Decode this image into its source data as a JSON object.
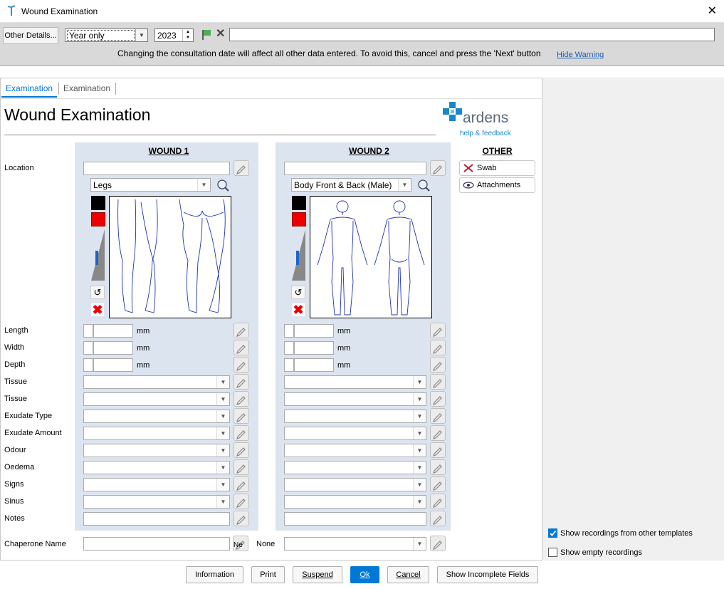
{
  "window": {
    "title": "Wound Examination"
  },
  "topbar": {
    "other_details_label": "Other Details...",
    "date_mode": "Year only",
    "year": "2023",
    "warning": "Changing the consultation date will affect all other data entered. To avoid this, cancel and press the 'Next' button",
    "hide_warning": "Hide Warning"
  },
  "tabs": [
    {
      "label": "Examination"
    },
    {
      "label": "Examination"
    }
  ],
  "page": {
    "title": "Wound Examination"
  },
  "logo": {
    "brand": "ardens",
    "tagline": "help & feedback"
  },
  "columns": {
    "wound1": "WOUND 1",
    "wound2": "WOUND 2",
    "other": "OTHER"
  },
  "wound1": {
    "diagram": "Legs"
  },
  "wound2": {
    "diagram": "Body Front & Back (Male)"
  },
  "labels": {
    "location": "Location",
    "length": "Length",
    "width": "Width",
    "depth": "Depth",
    "tissue1": "Tissue",
    "tissue2": "Tissue",
    "exudate_type": "Exudate Type",
    "exudate_amount": "Exudate Amount",
    "odour": "Odour",
    "oedema": "Oedema",
    "signs": "Signs",
    "sinus": "Sinus",
    "notes": "Notes",
    "chaperone": "Chaperone Name",
    "chaperone_extra": "Ne",
    "none": "None"
  },
  "units": {
    "mm": "mm"
  },
  "other_buttons": {
    "swab": "Swab",
    "attachments": "Attachments"
  },
  "options": {
    "show_other_templates": "Show recordings from other templates",
    "show_empty": "Show empty recordings",
    "show_other_templates_checked": true,
    "show_empty_checked": false
  },
  "buttons": {
    "information": "Information",
    "print": "Print",
    "suspend": "Suspend",
    "ok": "Ok",
    "cancel": "Cancel",
    "show_incomplete": "Show Incomplete Fields"
  },
  "colors": {
    "accent": "#0078d7",
    "column_bg": "#dce4ef",
    "logo_blue": "#1a87c6"
  }
}
